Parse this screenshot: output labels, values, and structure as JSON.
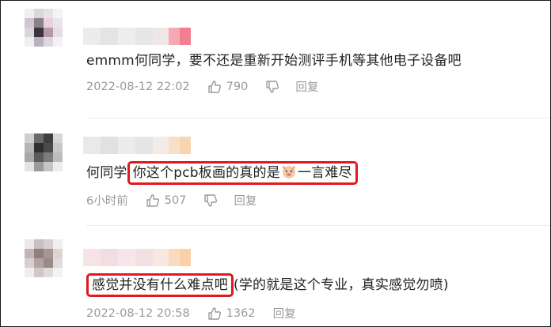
{
  "comments": [
    {
      "text": "emmm何同学，要不还是重新开始测评手机等其他电子设备吧",
      "time": "2022-08-12 22:02",
      "likes": "790",
      "reply_label": "回复"
    },
    {
      "text_prefix": "何同学",
      "text_highlight_a": "你这个pcb板画的真的是",
      "text_highlight_b": "一言难尽",
      "emoji_name": "pig-face-emoji",
      "time": "6小时前",
      "likes": "507",
      "reply_label": "回复"
    },
    {
      "text_highlight": "感觉并没有什么难点吧",
      "text_suffix": "(学的就是这个专业，真实感觉勿喷)",
      "time": "2022-08-12 20:58",
      "likes": "1362",
      "reply_label": "回复"
    }
  ],
  "colors": {
    "highlight_border": "#e0191e",
    "meta_text": "#9a9a9a",
    "comment_text": "#222222"
  },
  "icons": {
    "like": "thumbs-up-icon",
    "dislike": "thumbs-down-icon"
  }
}
